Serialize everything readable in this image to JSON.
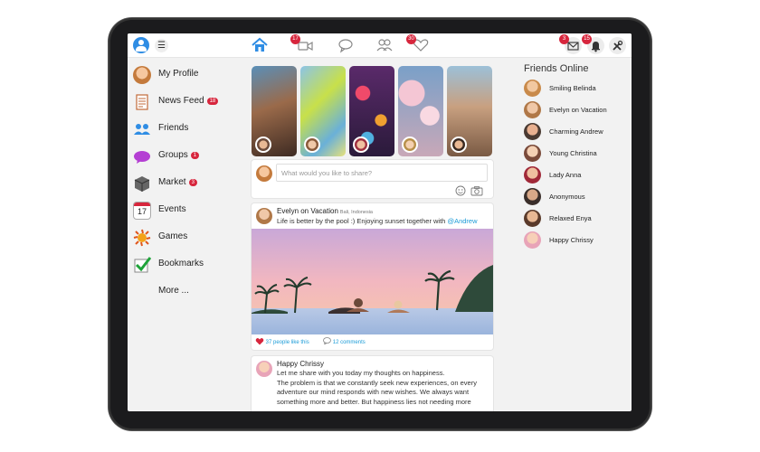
{
  "topbar": {
    "menu_glyph": "☰",
    "badges": {
      "video": "17",
      "likes": "30",
      "messages": "3",
      "notifications": "15"
    },
    "icons": [
      "user-avatar-icon",
      "menu-icon",
      "home-icon",
      "video-icon",
      "chat-icon",
      "people-icon",
      "heart-icon",
      "mail-icon",
      "bell-icon",
      "tools-icon"
    ],
    "accent_color": "#2f8de4",
    "badge_color": "#d7263d"
  },
  "sidebar": {
    "items": [
      {
        "label": "My Profile",
        "badge": ""
      },
      {
        "label": "News Feed",
        "badge": "18"
      },
      {
        "label": "Friends",
        "badge": ""
      },
      {
        "label": "Groups",
        "badge": "1"
      },
      {
        "label": "Market",
        "badge": "3"
      },
      {
        "label": "Events",
        "badge": "",
        "icon_text": "17"
      },
      {
        "label": "Games",
        "badge": ""
      },
      {
        "label": "Bookmarks",
        "badge": ""
      },
      {
        "label": "More ...",
        "badge": ""
      }
    ]
  },
  "composer": {
    "placeholder": "What would you like to share?"
  },
  "post1": {
    "author": "Evelyn on Vacation",
    "location": "Bali, Indonesia",
    "text_before": "Life is better by the pool :) Enjoying sunset together with ",
    "mention": "@Andrew",
    "likes": "37 people like this",
    "comments": "12 comments"
  },
  "post2": {
    "author": "Happy Chrissy",
    "line1": "Let me share with you today my thoughts on happiness.",
    "line2": "The problem is that we constantly seek new experiences, on every adventure our mind responds with new wishes. We always want something more and better. But happiness lies not needing more"
  },
  "friends_online": {
    "title": "Friends Online",
    "names": [
      "Smiling Belinda",
      "Evelyn on Vacation",
      "Charming Andrew",
      "Young Christina",
      "Lady Anna",
      "Anonymous",
      "Relaxed Enya",
      "Happy Chrissy"
    ]
  }
}
